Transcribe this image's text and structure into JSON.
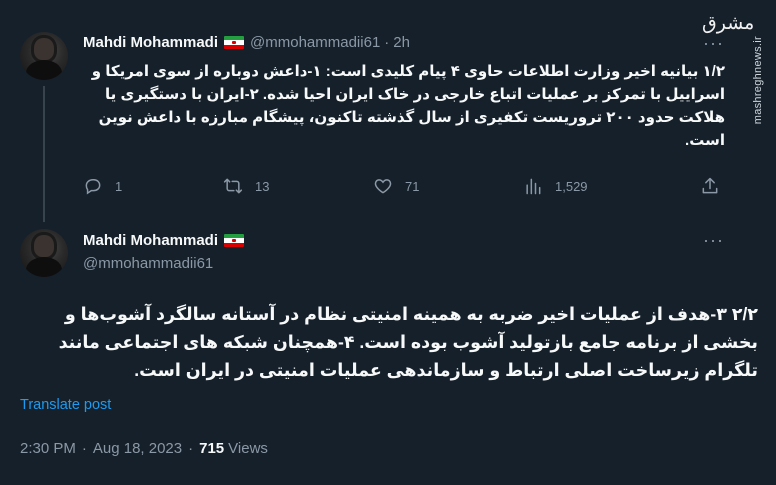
{
  "watermark": {
    "logo": "مشرق",
    "url": "mashreghnews.ir"
  },
  "tweet1": {
    "name": "Mahdi Mohammadi",
    "handle": "@mmohammadii61",
    "separator": "·",
    "time": "2h",
    "text": "۱/۲ بیانیه اخیر وزارت اطلاعات حاوی ۴ پیام کلیدی است: ۱-داعش دوباره از سوی امریکا و اسراییل با تمرکز بر عملیات اتباع خارجی در خاک ایران احیا شده. ۲-ایران با دستگیری یا هلاکت حدود ۲۰۰ تروریست تکفیری از سال گذشته تاکنون، پیشگام مبارزه با داعش نوین است.",
    "more": "···",
    "actions": {
      "replies": "1",
      "retweets": "13",
      "likes": "71",
      "views": "1,529"
    }
  },
  "tweet2": {
    "name": "Mahdi Mohammadi",
    "handle": "@mmohammadii61",
    "more": "···",
    "text": "۲/۲  ۳-هدف از عملیات اخیر ضربه به همینه امنیتی نظام در آستانه سالگرد آشوب‌ها و بخشی از برنامه جامع بازتولید آشوب بوده است. ۴-همچنان شبکه های اجتماعی مانند تلگرام زیرساخت اصلی ارتباط و سازماندهی عملیات امنیتی در ایران است.",
    "translate": "Translate post",
    "time": "2:30 PM",
    "date": "Aug 18, 2023",
    "separator": "·",
    "views_count": "715",
    "views_label": "Views"
  },
  "colors": {
    "background": "#15202b",
    "text": "#f7f9f9",
    "secondary": "#8b98a5",
    "accent": "#1d9bf0",
    "thread_line": "#38444d"
  },
  "icons": [
    "reply-icon",
    "retweet-icon",
    "like-icon",
    "views-icon",
    "share-icon",
    "more-icon",
    "iran-flag-icon"
  ]
}
